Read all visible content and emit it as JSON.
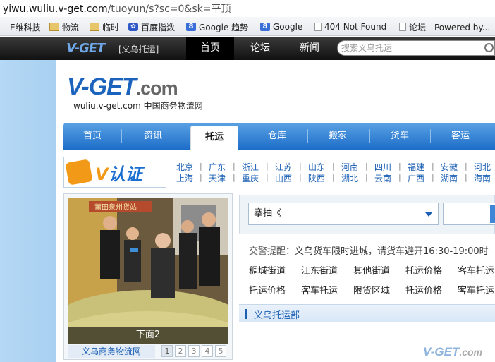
{
  "browser": {
    "url_host": "yiwu.wuliu.v-get.com",
    "url_path": "/tuoyun/s?sc=0&sk=平顶",
    "bookmarks": [
      {
        "label": "E维科技",
        "icon": "page-icon"
      },
      {
        "label": "物流",
        "icon": "folder-icon"
      },
      {
        "label": "临时",
        "icon": "folder-icon"
      },
      {
        "label": "百度指数",
        "icon": "baidu-paw-icon"
      },
      {
        "label": "Google 趋势",
        "icon": "google-icon"
      },
      {
        "label": "Google",
        "icon": "google-icon"
      },
      {
        "label": "404 Not Found",
        "icon": "page-icon"
      },
      {
        "label": "论坛 - Powered by...",
        "icon": "page-icon"
      }
    ]
  },
  "topnav": {
    "logo": "V-GET",
    "site": "[义乌托运]",
    "items": [
      "首页",
      "论坛",
      "新闻"
    ],
    "search_placeholder": "搜索义乌托运"
  },
  "header": {
    "logo_main": "V-GET",
    "logo_domain": ".com",
    "domain": "wuliu.v-get.com",
    "tagline": "中国商务物流网"
  },
  "mainnav": {
    "items": [
      "首页",
      "资讯",
      "托运",
      "仓库",
      "搬家",
      "货车",
      "客运"
    ],
    "active": "托运"
  },
  "vauth": {
    "label": "V认证",
    "v": "V",
    "rest": "认证"
  },
  "cities": {
    "row1": [
      "北京",
      "广东",
      "浙江",
      "江苏",
      "山东",
      "河南",
      "四川",
      "福建",
      "安徽",
      "河北"
    ],
    "row2": [
      "上海",
      "天津",
      "重庆",
      "山西",
      "陕西",
      "湖北",
      "云南",
      "广西",
      "湖南",
      "海南"
    ]
  },
  "slideshow": {
    "caption": "下面2",
    "link": "义乌商务物流网",
    "pages": [
      "1",
      "2",
      "3",
      "4",
      "5"
    ],
    "current_page": "1",
    "banner_text": "莆田泉州货站"
  },
  "search": {
    "selected": "搴抽《",
    "input_value": ""
  },
  "notice": {
    "label": "交警提醒：",
    "text": "义乌货车限时进城，请货车避开16:30-19:00时"
  },
  "keywords": {
    "row1": [
      "稠城街道",
      "江东街道",
      "其他街道",
      "托运价格",
      "客车托运"
    ],
    "row2": [
      "托运价格",
      "客车托运",
      "限货区域",
      "托运价格",
      "客车托运"
    ]
  },
  "section": {
    "title": "义乌托运部"
  },
  "watermark": {
    "main": "V-GET",
    "domain": ".com"
  },
  "colors": {
    "brand_blue": "#1c63bd",
    "brand_orange": "#f39a1d",
    "nav_blue": "#1d6dc9"
  }
}
